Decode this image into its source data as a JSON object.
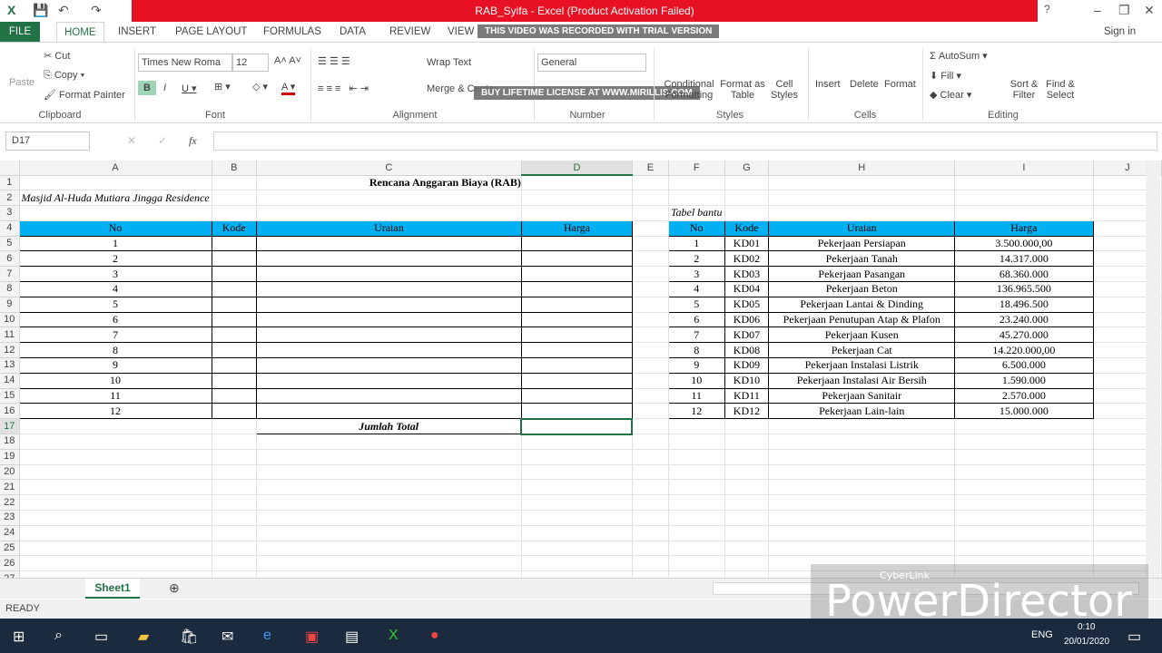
{
  "window": {
    "title": "RAB_Syifa -  Excel (Product Activation Failed)",
    "sign_in": "Sign in"
  },
  "tabs": [
    "FILE",
    "HOME",
    "INSERT",
    "PAGE LAYOUT",
    "FORMULAS",
    "DATA",
    "REVIEW",
    "VIEW"
  ],
  "watermark": {
    "top": "THIS VIDEO WAS RECORDED WITH TRIAL VERSION",
    "bottom": "BUY LIFETIME LICENSE AT WWW.MIRILLIS.COM",
    "powerdirector": "PowerDirector",
    "cyberlink": "CyberLink"
  },
  "ribbon": {
    "paste": "Paste",
    "cut": "Cut",
    "copy": "Copy",
    "format_painter": "Format Painter",
    "font_name": "Times New Roma",
    "font_size": "12",
    "wrap_text": "Wrap Text",
    "merge": "Merge & Center",
    "number_format": "General",
    "conditional": "Conditional Formatting",
    "format_table": "Format as Table",
    "cell_styles": "Cell Styles",
    "insert": "Insert",
    "delete": "Delete",
    "format": "Format",
    "autosum": "AutoSum",
    "fill": "Fill",
    "clear": "Clear",
    "sort": "Sort & Filter",
    "find": "Find & Select",
    "groups": [
      "Clipboard",
      "Font",
      "Alignment",
      "Number",
      "Styles",
      "Cells",
      "Editing"
    ]
  },
  "formula_bar": {
    "name_box": "D17",
    "fx": "fx",
    "value": ""
  },
  "columns": [
    "A",
    "B",
    "C",
    "D",
    "E",
    "F",
    "G",
    "H",
    "I",
    "J"
  ],
  "selected_cell": "D17",
  "sheet": {
    "title": "Rencana Anggaran Biaya (RAB)",
    "subtitle": "Masjid Al-Huda Mutiara Jingga Residence",
    "main_headers": [
      "No",
      "Kode",
      "Uraian",
      "Harga"
    ],
    "main_numbers": [
      "1",
      "2",
      "3",
      "4",
      "5",
      "6",
      "7",
      "8",
      "9",
      "10",
      "11",
      "12"
    ],
    "total_label": "Jumlah Total",
    "helper_label": "Tabel bantu",
    "helper_headers": [
      "No",
      "Kode",
      "Uraian",
      "Harga"
    ],
    "helper_rows": [
      [
        "1",
        "KD01",
        "Pekerjaan Persiapan",
        "3.500.000,00"
      ],
      [
        "2",
        "KD02",
        "Pekerjaan Tanah",
        "14.317.000"
      ],
      [
        "3",
        "KD03",
        "Pekerjaan Pasangan",
        "68.360.000"
      ],
      [
        "4",
        "KD04",
        "Pekerjaan Beton",
        "136.965.500"
      ],
      [
        "5",
        "KD05",
        "Pekerjaan Lantai & Dinding",
        "18.496.500"
      ],
      [
        "6",
        "KD06",
        "Pekerjaan Penutupan Atap & Plafon",
        "23.240.000"
      ],
      [
        "7",
        "KD07",
        "Pekerjaan Kusen",
        "45.270.000"
      ],
      [
        "8",
        "KD08",
        "Pekerjaan Cat",
        "14.220.000,00"
      ],
      [
        "9",
        "KD09",
        "Pekerjaan Instalasi Listrik",
        "6.500.000"
      ],
      [
        "10",
        "KD10",
        "Pekerjaan Instalasi Air Bersih",
        "1.590.000"
      ],
      [
        "11",
        "KD11",
        "Pekerjaan Sanitair",
        "2.570.000"
      ],
      [
        "12",
        "KD12",
        "Pekerjaan Lain-lain",
        "15.000.000"
      ]
    ]
  },
  "sheet_tabs": [
    "Sheet1"
  ],
  "status": "READY",
  "taskbar": {
    "lang": "ENG",
    "time": "0:10",
    "date": "20/01/2020"
  },
  "colors": {
    "accent": "#217346",
    "header_fill": "#00b0f0",
    "title_bar": "#e81123"
  }
}
